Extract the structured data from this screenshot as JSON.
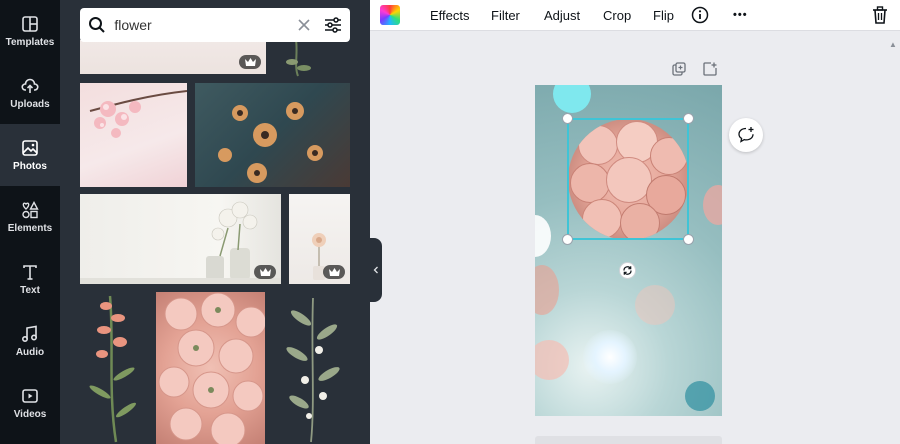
{
  "rail": {
    "items": [
      {
        "label": "Templates",
        "icon": "templates-icon"
      },
      {
        "label": "Uploads",
        "icon": "upload-icon"
      },
      {
        "label": "Photos",
        "icon": "photo-icon",
        "active": true
      },
      {
        "label": "Elements",
        "icon": "elements-icon"
      },
      {
        "label": "Text",
        "icon": "text-icon"
      },
      {
        "label": "Audio",
        "icon": "music-icon"
      },
      {
        "label": "Videos",
        "icon": "video-icon"
      }
    ]
  },
  "search": {
    "value": "flower",
    "placeholder": "Search photos"
  },
  "toolbar": {
    "effects": "Effects",
    "filter": "Filter",
    "adjust": "Adjust",
    "crop": "Crop",
    "flip": "Flip",
    "more": "•••"
  },
  "colors": {
    "accent": "#3fc4d6",
    "rail_bg": "#0e1318",
    "panel_bg": "#293039",
    "canvas_bg": "#ebecf0"
  }
}
